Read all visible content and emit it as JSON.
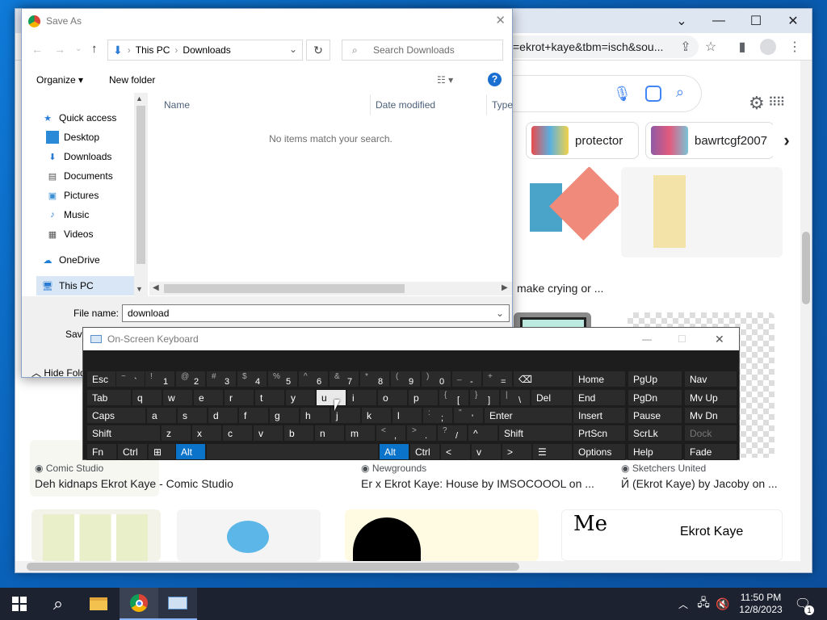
{
  "chrome": {
    "url": "=ekrot+kaye&tbm=isch&sou...",
    "chips": [
      {
        "label": "protector"
      },
      {
        "label": "bawrtcgf2007"
      }
    ],
    "results": [
      {
        "caption": "make crying or ..."
      },
      {
        "source": "Comic Studio",
        "title": "Deh kidnaps Ekrot Kaye - Comic Studio"
      },
      {
        "source": "Newgrounds",
        "title": "Er x Ekrot Kaye: House by IMSOCOOOL on ..."
      },
      {
        "source": "Sketchers United",
        "title": "Й (Ekrot Kaye) by Jacoby on ..."
      }
    ],
    "thumb_text_me": "Me",
    "thumb_text_ekrot": "Ekrot Kaye"
  },
  "dialog": {
    "title": "Save As",
    "path": [
      "This PC",
      "Downloads"
    ],
    "search_placeholder": "Search Downloads",
    "organize_label": "Organize",
    "new_folder_label": "New folder",
    "nav_items": [
      {
        "label": "Quick access",
        "icon": "star-icon"
      },
      {
        "label": "Desktop",
        "icon": "desktop-icon",
        "pinned": true
      },
      {
        "label": "Downloads",
        "icon": "download-icon",
        "pinned": true
      },
      {
        "label": "Documents",
        "icon": "document-icon",
        "pinned": true
      },
      {
        "label": "Pictures",
        "icon": "pictures-icon",
        "pinned": true
      },
      {
        "label": "Music",
        "icon": "music-icon"
      },
      {
        "label": "Videos",
        "icon": "video-icon"
      },
      {
        "label": "OneDrive",
        "icon": "cloud-icon"
      },
      {
        "label": "This PC",
        "icon": "computer-icon"
      }
    ],
    "columns": [
      "Name",
      "Date modified",
      "Type"
    ],
    "empty_message": "No items match your search.",
    "file_name_label": "File name:",
    "file_name_value": "download",
    "save_as_type_label": "Save",
    "hide_folders_label": "Hide Fold"
  },
  "osk": {
    "title": "On-Screen Keyboard",
    "rows": [
      {
        "keys": [
          {
            "label": "Esc"
          },
          {
            "sup": "~",
            "main": "`"
          },
          {
            "sup": "!",
            "main": "1"
          },
          {
            "sup": "@",
            "main": "2"
          },
          {
            "sup": "#",
            "main": "3"
          },
          {
            "sup": "$",
            "main": "4"
          },
          {
            "sup": "%",
            "main": "5"
          },
          {
            "sup": "^",
            "main": "6"
          },
          {
            "sup": "&",
            "main": "7"
          },
          {
            "sup": "*",
            "main": "8"
          },
          {
            "sup": "(",
            "main": "9"
          },
          {
            "sup": ")",
            "main": "0"
          },
          {
            "sup": "_",
            "main": "-"
          },
          {
            "sup": "+",
            "main": "="
          },
          {
            "label": "⌫"
          }
        ]
      },
      {
        "keys": [
          {
            "label": "Tab"
          },
          {
            "label": "q"
          },
          {
            "label": "w"
          },
          {
            "label": "e"
          },
          {
            "label": "r"
          },
          {
            "label": "t"
          },
          {
            "label": "y"
          },
          {
            "label": "u"
          },
          {
            "label": "i"
          },
          {
            "label": "o"
          },
          {
            "label": "p"
          },
          {
            "sup": "{",
            "main": "["
          },
          {
            "sup": "}",
            "main": "]"
          },
          {
            "sup": "|",
            "main": "\\"
          },
          {
            "label": "Del"
          }
        ]
      },
      {
        "keys": [
          {
            "label": "Caps"
          },
          {
            "label": "a"
          },
          {
            "label": "s"
          },
          {
            "label": "d"
          },
          {
            "label": "f"
          },
          {
            "label": "g"
          },
          {
            "label": "h"
          },
          {
            "label": "j"
          },
          {
            "label": "k"
          },
          {
            "label": "l"
          },
          {
            "sup": ":",
            "main": ";"
          },
          {
            "sup": "\"",
            "main": "'"
          },
          {
            "label": "Enter"
          }
        ]
      },
      {
        "keys": [
          {
            "label": "Shift"
          },
          {
            "label": "z"
          },
          {
            "label": "x"
          },
          {
            "label": "c"
          },
          {
            "label": "v"
          },
          {
            "label": "b"
          },
          {
            "label": "n"
          },
          {
            "label": "m"
          },
          {
            "sup": "<",
            "main": ","
          },
          {
            "sup": ">",
            "main": "."
          },
          {
            "sup": "?",
            "main": "/"
          },
          {
            "label": "^"
          },
          {
            "label": "Shift"
          }
        ]
      },
      {
        "keys": [
          {
            "label": "Fn"
          },
          {
            "label": "Ctrl"
          },
          {
            "label": "⊞"
          },
          {
            "label": "Alt"
          },
          {
            "label": ""
          },
          {
            "label": "Alt"
          },
          {
            "label": "Ctrl"
          },
          {
            "label": "<"
          },
          {
            "label": "v"
          },
          {
            "label": ">"
          },
          {
            "label": "☰"
          }
        ]
      }
    ],
    "nav_cols": [
      [
        "Home",
        "End",
        "Insert",
        "PrtScn",
        "Options"
      ],
      [
        "PgUp",
        "PgDn",
        "Pause",
        "ScrLk",
        "Help"
      ],
      [
        "Nav",
        "Mv Up",
        "Mv Dn",
        "Dock",
        "Fade"
      ]
    ]
  },
  "taskbar": {
    "time": "11:50 PM",
    "date": "12/8/2023",
    "notification_count": "1"
  },
  "colors": {
    "accent": "#0b73c9",
    "taskbar": "#1c2230",
    "osk_key": "#2b2b2b"
  }
}
